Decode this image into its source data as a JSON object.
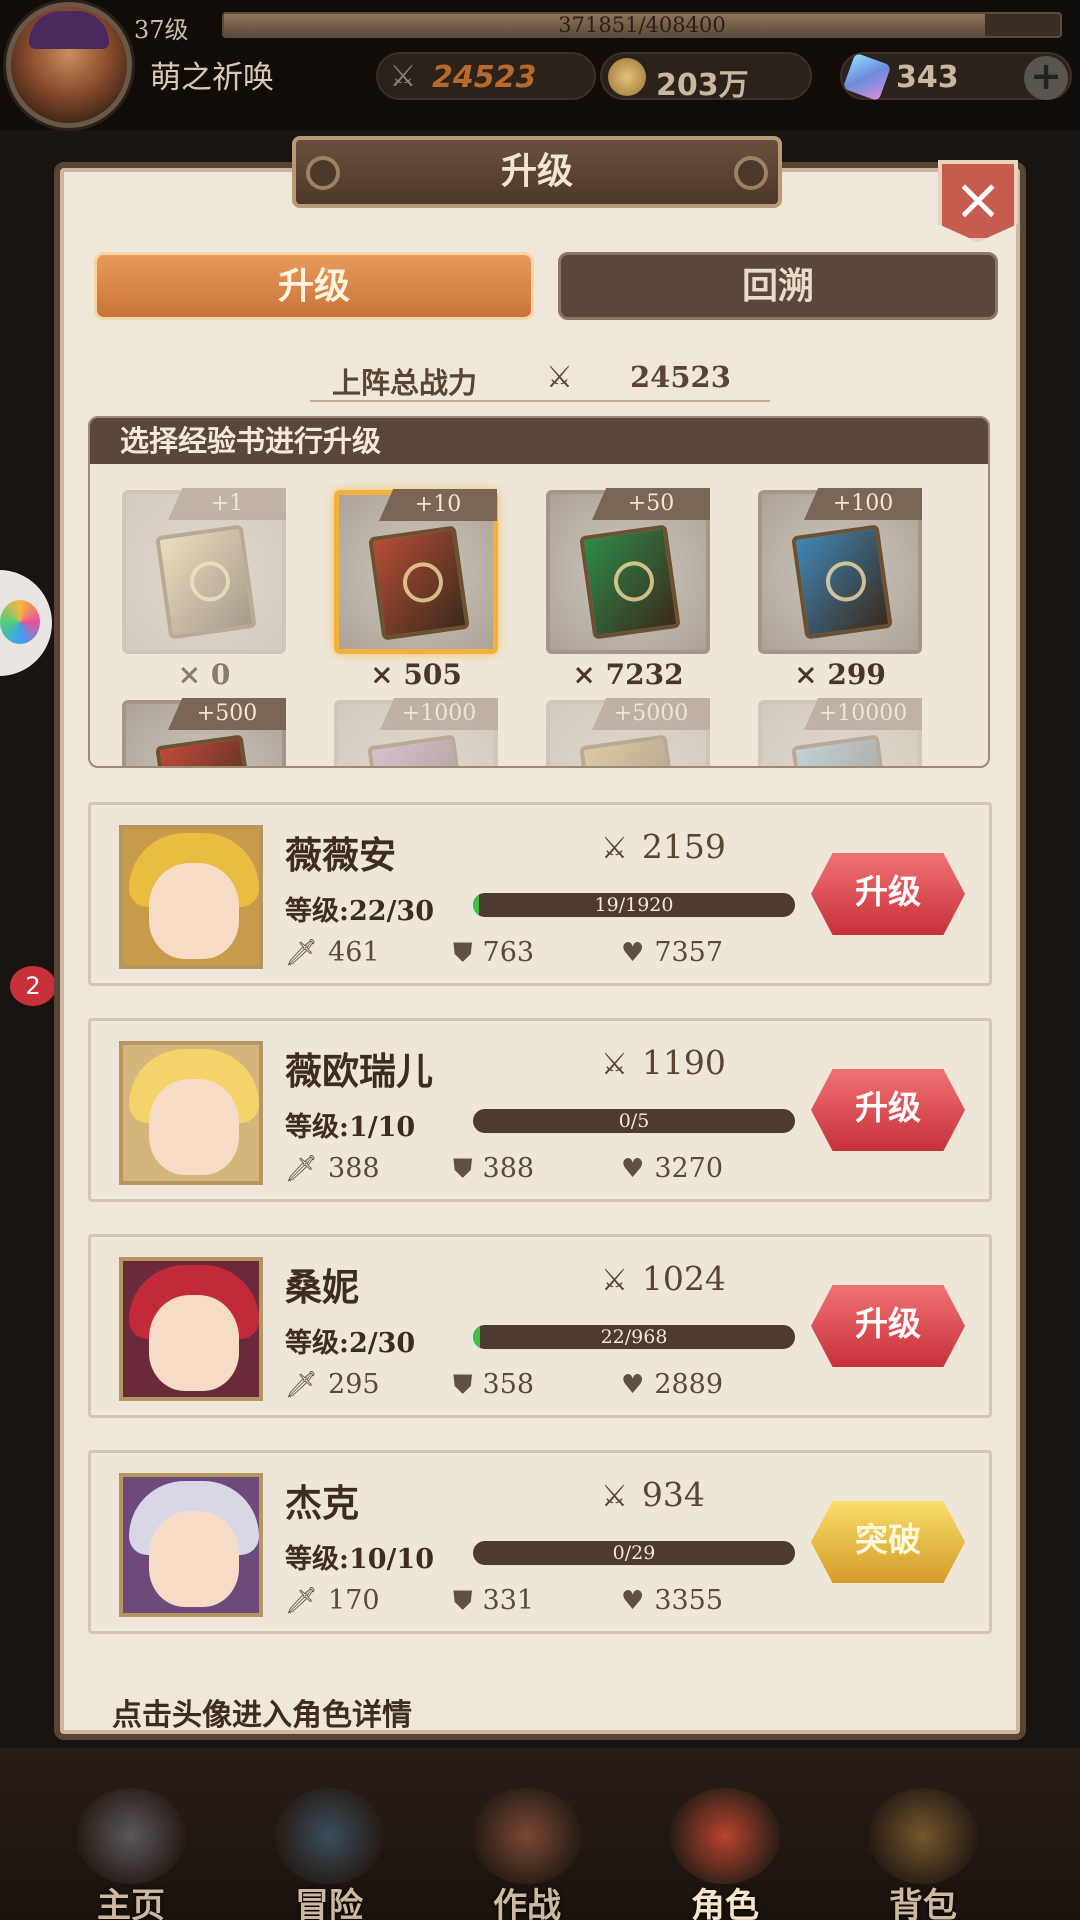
{
  "player": {
    "level": "37级",
    "exp": "371851/408400",
    "exp_fraction": 0.91,
    "name": "萌之祈唤"
  },
  "currency": {
    "combat_power": "24523",
    "gold": "203万",
    "gems": "343",
    "add_icon": "plus-icon"
  },
  "panel": {
    "title": "升级",
    "close_icon": "×",
    "tabs": [
      {
        "label": "升级",
        "active": true
      },
      {
        "label": "回溯",
        "active": false
      }
    ],
    "total_power_label": "上阵总战力",
    "total_power_value": "24523",
    "books_header": "选择经验书进行升级",
    "books": [
      {
        "tag": "+1",
        "count": "× 0",
        "selected": false,
        "dim": true,
        "color": "#e8d39a"
      },
      {
        "tag": "+10",
        "count": "× 505",
        "selected": true,
        "dim": false,
        "color": "#b54e35"
      },
      {
        "tag": "+50",
        "count": "× 7232",
        "selected": false,
        "dim": false,
        "color": "#2f8a4b"
      },
      {
        "tag": "+100",
        "count": "× 299",
        "selected": false,
        "dim": false,
        "color": "#3f86b6"
      },
      {
        "tag": "+500",
        "count": "",
        "selected": false,
        "dim": false,
        "color": "#c04a3a"
      },
      {
        "tag": "+1000",
        "count": "",
        "selected": false,
        "dim": true,
        "color": "#b58ac0"
      },
      {
        "tag": "+5000",
        "count": "",
        "selected": false,
        "dim": true,
        "color": "#c9a050"
      },
      {
        "tag": "+10000",
        "count": "",
        "selected": false,
        "dim": true,
        "color": "#7fb5d6"
      }
    ],
    "characters": [
      {
        "name": "薇薇安",
        "power": "2159",
        "level": "等级:22/30",
        "exp": "19/1920",
        "exp_fraction": 0.01,
        "atk": "461",
        "def": "763",
        "hp": "7357",
        "action": "升级",
        "action_type": "red",
        "hair": "#e9bd3f",
        "bg": "#c79b4a"
      },
      {
        "name": "薇欧瑞儿",
        "power": "1190",
        "level": "等级:1/10",
        "exp": "0/5",
        "exp_fraction": 0.0,
        "atk": "388",
        "def": "388",
        "hp": "3270",
        "action": "升级",
        "action_type": "red",
        "hair": "#f3d36a",
        "bg": "#d4b57c"
      },
      {
        "name": "桑妮",
        "power": "1024",
        "level": "等级:2/30",
        "exp": "22/968",
        "exp_fraction": 0.023,
        "atk": "295",
        "def": "358",
        "hp": "2889",
        "action": "升级",
        "action_type": "red",
        "hair": "#c22a3a",
        "bg": "#6b2a3b"
      },
      {
        "name": "杰克",
        "power": "934",
        "level": "等级:10/10",
        "exp": "0/29",
        "exp_fraction": 0.0,
        "atk": "170",
        "def": "331",
        "hp": "3355",
        "action": "突破",
        "action_type": "gold",
        "hair": "#d9d6e6",
        "bg": "#6e4a7a"
      }
    ],
    "hint": "点击头像进入角色详情"
  },
  "side": {
    "badge": "2"
  },
  "nav": [
    {
      "label": "主页",
      "active": false,
      "color": "#8c8c9c"
    },
    {
      "label": "冒险",
      "active": false,
      "color": "#4a7a9a"
    },
    {
      "label": "作战",
      "active": false,
      "color": "#c07050"
    },
    {
      "label": "角色",
      "active": true,
      "color": "#b8442e"
    },
    {
      "label": "背包",
      "active": false,
      "color": "#b88a40"
    }
  ]
}
